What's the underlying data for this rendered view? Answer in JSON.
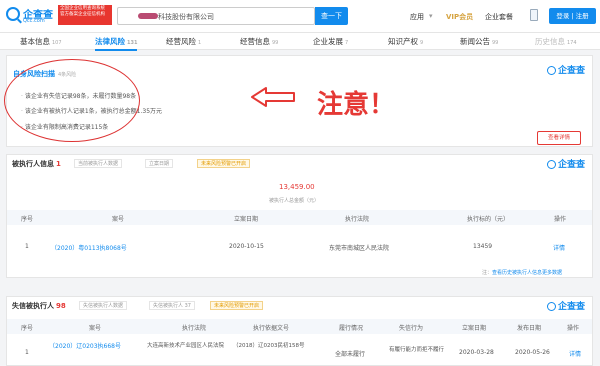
{
  "header": {
    "logo_name": "企查查",
    "logo_domain": "Qcc.com",
    "promo_text": "全国企业信用查询系统 官方备案企业征信机构",
    "search_value": "科技股份有限公司",
    "search_button": "查一下",
    "nav": [
      "应用",
      "VIP会员",
      "企业套餐"
    ],
    "login_button": "登录 | 注册"
  },
  "tabs": [
    {
      "label": "基本信息",
      "count": "107"
    },
    {
      "label": "法律风险",
      "count": "131"
    },
    {
      "label": "经营风险",
      "count": "1"
    },
    {
      "label": "经营信息",
      "count": "99"
    },
    {
      "label": "企业发展",
      "count": "7"
    },
    {
      "label": "知识产权",
      "count": "9"
    },
    {
      "label": "新闻公告",
      "count": "99"
    },
    {
      "label": "历史信息",
      "count": "174"
    }
  ],
  "risk_summary": {
    "title": "自身风险扫描",
    "count": "4条风险",
    "items": [
      "该企业有失信记录98条，未履行数量98条",
      "该企业有被执行人记录1条，被执行总金额1.35万元",
      "该企业有限制高消费记录115条"
    ],
    "button": "查看详情",
    "annotation": "注意！"
  },
  "watermark": "企查查",
  "executed": {
    "title": "被执行人信息",
    "count": "1",
    "filters": [
      "当前被执行人数据",
      "立案日期"
    ],
    "tag": "未来风险预警已开启",
    "total_amount": "13,459.00",
    "total_label": "被执行人总金额（元）",
    "columns": [
      "序号",
      "案号",
      "立案日期",
      "执行法院",
      "执行标的（元）",
      "操作"
    ],
    "rows": [
      {
        "no": "1",
        "case": "（2020）粤0113执8068号",
        "date": "2020-10-15",
        "court": "东莞市南城区人民法院",
        "amount": "13459",
        "action": "详情"
      }
    ],
    "hint_prefix": "注：",
    "hint_link": "查看历史被执行人信息更多数据"
  },
  "dishonest": {
    "title": "失信被执行人",
    "count": "98",
    "filters": [
      "失信被执行人数据",
      "失信被执行人 37"
    ],
    "tag": "未来风险预警已开启",
    "columns": [
      "序号",
      "案号",
      "执行法院",
      "执行依据文号",
      "履行情况",
      "失信行为",
      "立案日期",
      "发布日期",
      "操作"
    ],
    "rows": [
      {
        "no": "1",
        "case": "（2020）辽0203执668号",
        "court": "大连高新技术产业园区人民法院",
        "basis": "（2018）辽0203民初158号",
        "status": "全部未履行",
        "behavior": "有履行能力而拒不履行",
        "date": "2020-03-28",
        "pub": "2020-05-26",
        "action": "详情"
      }
    ]
  }
}
